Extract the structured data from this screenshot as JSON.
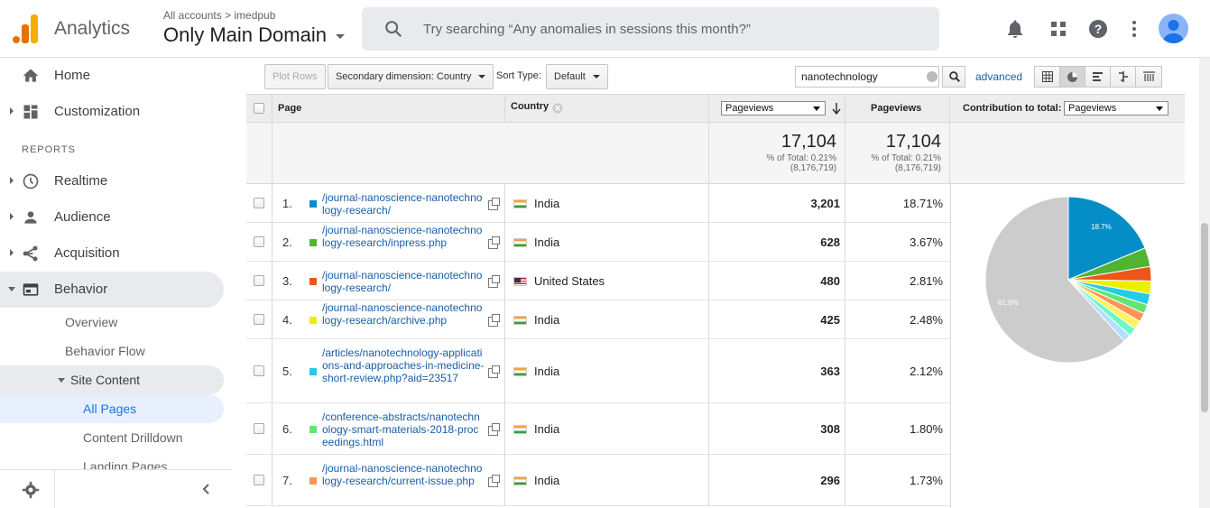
{
  "app": {
    "product": "Analytics",
    "breadcrumb": "All accounts > imedpub",
    "view_name": "Only Main Domain",
    "search_placeholder": "Try searching “Any anomalies in sessions this month?”",
    "icons": [
      "bell-icon",
      "apps-grid-icon",
      "help-icon",
      "more-vert-icon",
      "account-avatar"
    ]
  },
  "sidebar": {
    "items": [
      {
        "label": "Home",
        "icon": "home-icon"
      },
      {
        "label": "Customization",
        "icon": "dashboard-icon"
      }
    ],
    "reports_heading": "REPORTS",
    "report_items": [
      {
        "label": "Realtime",
        "icon": "clock-icon"
      },
      {
        "label": "Audience",
        "icon": "person-icon"
      },
      {
        "label": "Acquisition",
        "icon": "acquisition-icon"
      },
      {
        "label": "Behavior",
        "icon": "behavior-icon"
      }
    ],
    "behavior_sub": [
      "Overview",
      "Behavior Flow",
      "Site Content",
      "All Pages",
      "Content Drilldown",
      "Landing Pages"
    ]
  },
  "toolbar": {
    "plot_rows": "Plot Rows",
    "secondary_dimension": "Secondary dimension: Country",
    "sort_type_label": "Sort Type:",
    "sort_type_value": "Default",
    "filter_value": "nanotechnology",
    "advanced": "advanced"
  },
  "table": {
    "headers": {
      "page": "Page",
      "country": "Country",
      "metric_select": "Pageviews",
      "pageviews": "Pageviews",
      "contribution_label": "Contribution to total:",
      "contribution_select": "Pageviews"
    },
    "totals": {
      "value": "17,104",
      "pct_line": "% of Total: 0.21%",
      "of_total": "(8,176,719)"
    },
    "rows": [
      {
        "num": "1.",
        "page": "/journal-nanoscience-nanotechnology-research/",
        "country": "India",
        "flag": "in",
        "pageviews": "3,201",
        "pct": "18.71%",
        "color": "#058dc7"
      },
      {
        "num": "2.",
        "page": "/journal-nanoscience-nanotechnology-research/inpress.php",
        "country": "India",
        "flag": "in",
        "pageviews": "628",
        "pct": "3.67%",
        "color": "#50b432"
      },
      {
        "num": "3.",
        "page": "/journal-nanoscience-nanotechnology-research/",
        "country": "United States",
        "flag": "us",
        "pageviews": "480",
        "pct": "2.81%",
        "color": "#ed561b"
      },
      {
        "num": "4.",
        "page": "/journal-nanoscience-nanotechnology-research/archive.php",
        "country": "India",
        "flag": "in",
        "pageviews": "425",
        "pct": "2.48%",
        "color": "#edef00"
      },
      {
        "num": "5.",
        "page": "/articles/nanotechnology-applications-and-approaches-in-medicine-short-review.php?aid=23517",
        "country": "India",
        "flag": "in",
        "pageviews": "363",
        "pct": "2.12%",
        "color": "#24cbe5"
      },
      {
        "num": "6.",
        "page": "/conference-abstracts/nanotechnology-smart-materials-2018-proceedings.html",
        "country": "India",
        "flag": "in",
        "pageviews": "308",
        "pct": "1.80%",
        "color": "#64e572"
      },
      {
        "num": "7.",
        "page": "/journal-nanoscience-nanotechnology-research/current-issue.php",
        "country": "India",
        "flag": "in",
        "pageviews": "296",
        "pct": "1.73%",
        "color": "#ff9655"
      }
    ]
  },
  "pie": {
    "labels_shown": [
      "18.7%",
      "61.6%"
    ],
    "slices": [
      {
        "value": 18.71,
        "color": "#058dc7"
      },
      {
        "value": 3.67,
        "color": "#50b432"
      },
      {
        "value": 2.81,
        "color": "#ed561b"
      },
      {
        "value": 2.48,
        "color": "#edef00"
      },
      {
        "value": 2.12,
        "color": "#24cbe5"
      },
      {
        "value": 1.8,
        "color": "#64e572"
      },
      {
        "value": 1.73,
        "color": "#ff9655"
      },
      {
        "value": 1.7,
        "color": "#fff263"
      },
      {
        "value": 1.6,
        "color": "#6af9c4"
      },
      {
        "value": 1.5,
        "color": "#b2deff"
      },
      {
        "value": 61.6,
        "color": "#cccccc"
      }
    ]
  }
}
